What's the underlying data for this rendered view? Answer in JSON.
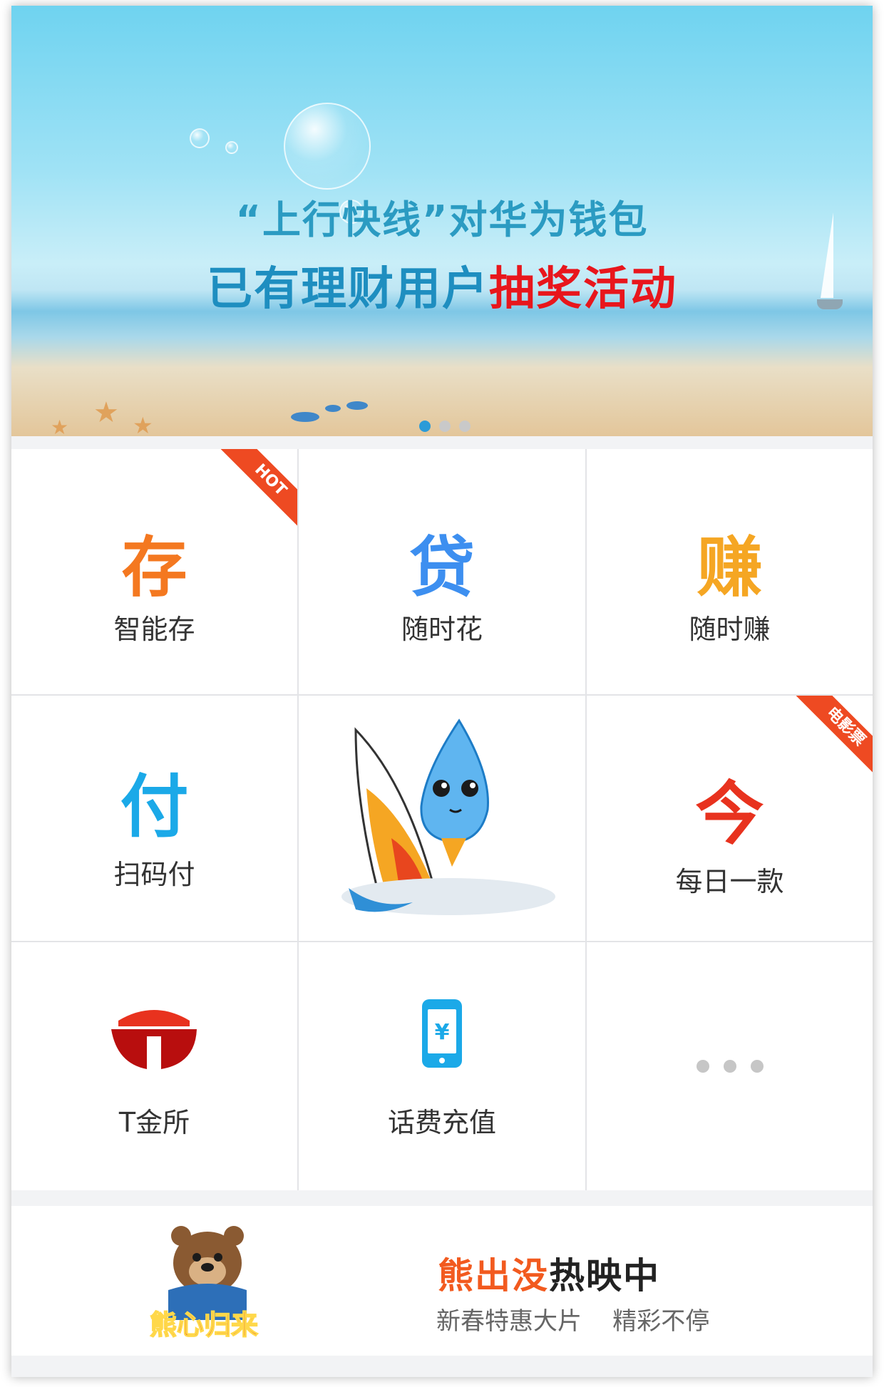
{
  "banner": {
    "headline_line1": "“上行快线”对华为钱包",
    "headline_line2_part1": "已有理财用户",
    "headline_line2_part2": "抽奖活动",
    "carousel_pages": 3,
    "carousel_active": 1,
    "colors": {
      "title_blue": "#2b9bc2",
      "accent_red": "#e8161c",
      "active_dot": "#2b9bd8"
    }
  },
  "grid": {
    "items": [
      {
        "label": "智能存",
        "icon": "deposit-icon",
        "glyph": "存",
        "color": "#f47820",
        "badge": "HOT"
      },
      {
        "label": "随时花",
        "icon": "loan-icon",
        "glyph": "贷",
        "color": "#3d8ff0",
        "badge": ""
      },
      {
        "label": "随时赚",
        "icon": "earn-icon",
        "glyph": "赚",
        "color": "#f5a623",
        "badge": ""
      },
      {
        "label": "扫码付",
        "icon": "scan-pay-icon",
        "glyph": "付",
        "color": "#1ba9e8",
        "badge": ""
      },
      {
        "label": "",
        "icon": "mascot-windsurf-icon",
        "glyph": "",
        "color": "#1d8fe0",
        "badge": ""
      },
      {
        "label": "每日一款",
        "icon": "daily-product-icon",
        "glyph": "今",
        "color": "#e8321e",
        "badge": "电影票"
      },
      {
        "label": "T金所",
        "icon": "t-exchange-icon",
        "glyph": "T",
        "color": "#c81414",
        "badge": ""
      },
      {
        "label": "话费充值",
        "icon": "phone-recharge-icon",
        "glyph": "¥",
        "color": "#1ba9e8",
        "badge": ""
      },
      {
        "label": "",
        "icon": "more-icon",
        "glyph": "",
        "color": "#c6c6c6",
        "badge": ""
      }
    ]
  },
  "promo": {
    "title_part1": "熊出没",
    "title_part2": "热映中",
    "subtitle": "新春特惠大片    精彩不停",
    "poster_text": "熊心归来",
    "colors": {
      "title_orange": "#f25a1f"
    }
  }
}
